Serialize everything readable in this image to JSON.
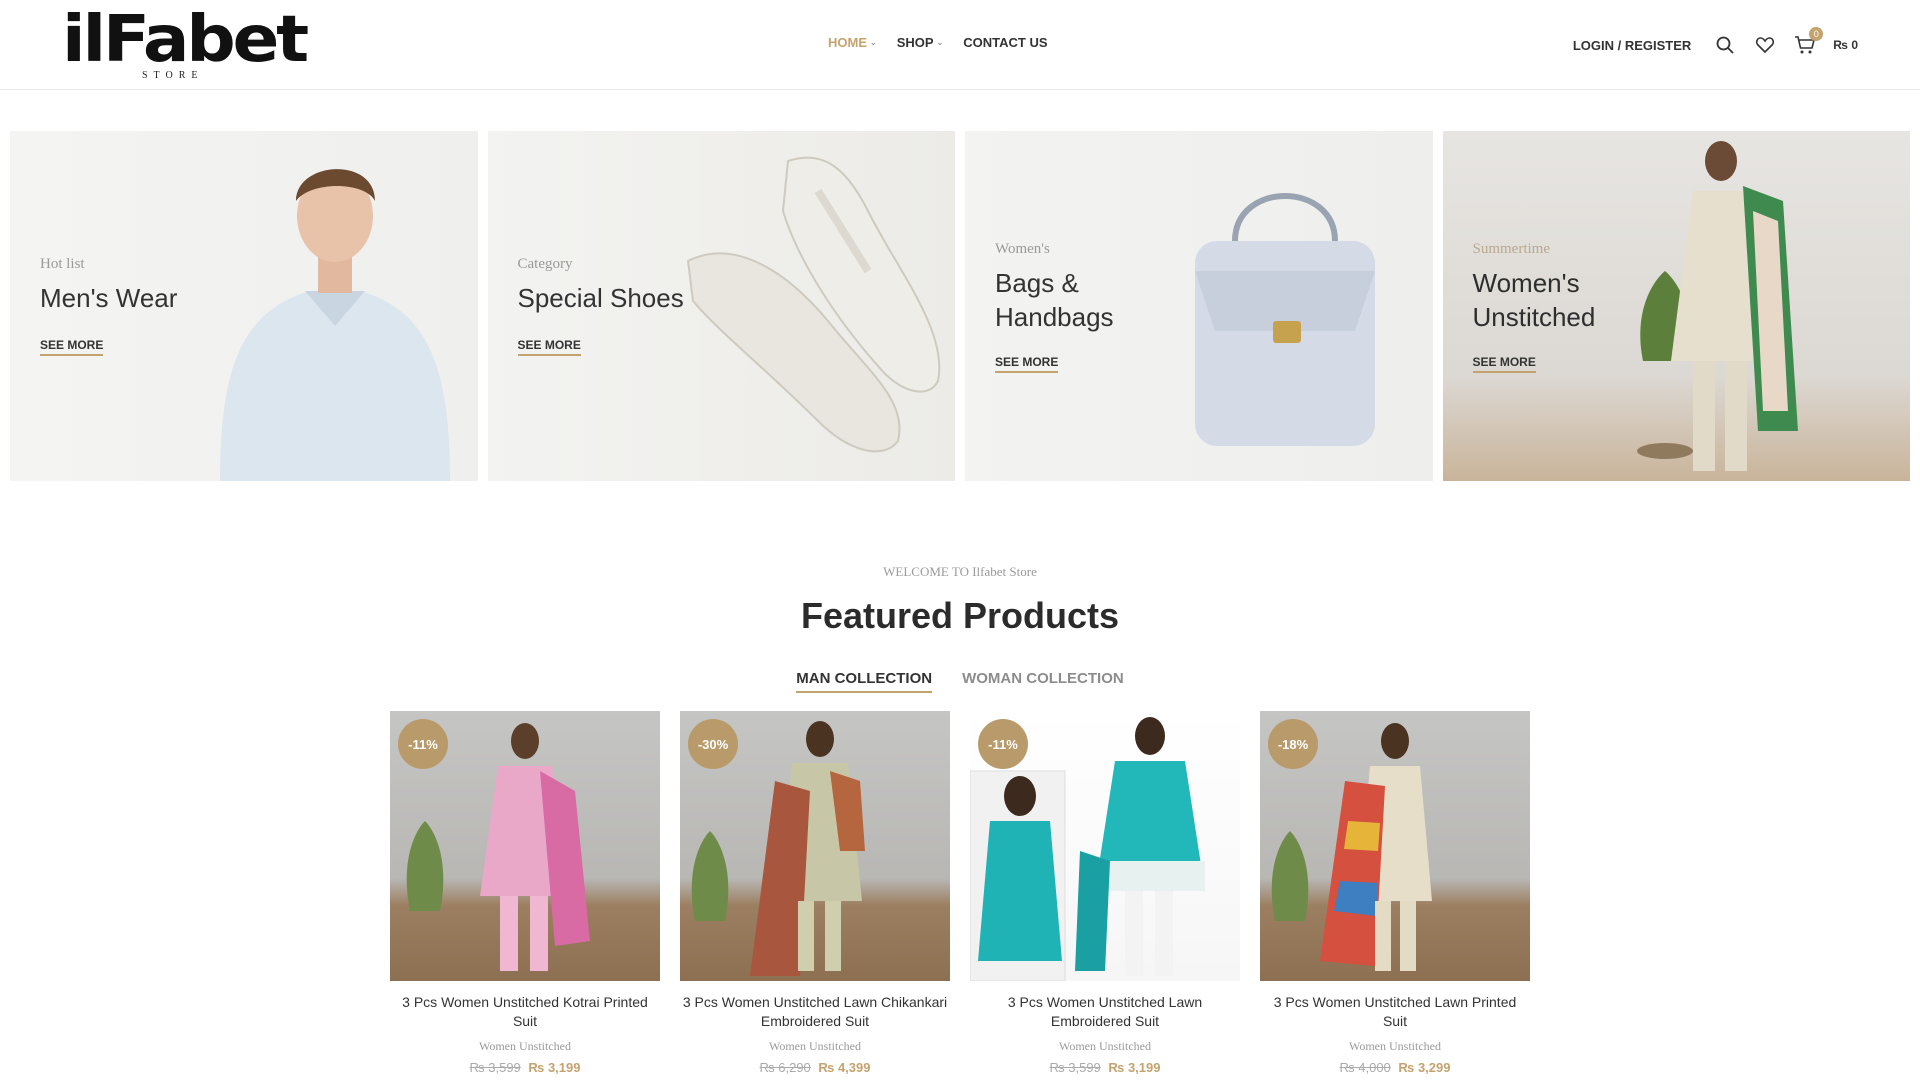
{
  "header": {
    "logo_text": "ilFabet",
    "logo_sub": "STORE",
    "nav": [
      {
        "label": "HOME",
        "active": true,
        "has_dropdown": true
      },
      {
        "label": "SHOP",
        "active": false,
        "has_dropdown": true
      },
      {
        "label": "CONTACT US",
        "active": false,
        "has_dropdown": false
      }
    ],
    "login_label": "LOGIN / REGISTER",
    "icons": [
      "search-icon",
      "heart-icon",
      "cart-icon"
    ],
    "cart_count": "0",
    "cart_total": "₨ 0"
  },
  "banners": [
    {
      "subtitle": "Hot list",
      "title": "Men's Wear",
      "link": "SEE MORE"
    },
    {
      "subtitle": "Category",
      "title": "Special Shoes",
      "link": "SEE MORE"
    },
    {
      "subtitle": "Women's",
      "title_line1": "Bags &",
      "title_line2": "Handbags",
      "link": "SEE MORE"
    },
    {
      "subtitle": "Summertime",
      "title_line1": "Women's",
      "title_line2": "Unstitched",
      "link": "SEE MORE"
    }
  ],
  "featured": {
    "welcome": "WELCOME TO Ilfabet Store",
    "title": "Featured Products",
    "tabs": [
      {
        "label": "MAN COLLECTION",
        "active": true
      },
      {
        "label": "WOMAN COLLECTION",
        "active": false
      }
    ],
    "products": [
      {
        "discount": "-11%",
        "name": "3 Pcs Women Unstitched Kotrai Printed Suit",
        "category": "Women Unstitched",
        "old_price": "₨ 3,599",
        "new_price": "₨ 3,199"
      },
      {
        "discount": "-30%",
        "name": "3 Pcs Women Unstitched Lawn Chikankari Embroidered Suit",
        "category": "Women Unstitched",
        "old_price": "₨ 6,290",
        "new_price": "₨ 4,399"
      },
      {
        "discount": "-11%",
        "name": "3 Pcs Women Unstitched Lawn Embroidered Suit",
        "category": "Women Unstitched",
        "old_price": "₨ 3,599",
        "new_price": "₨ 3,199"
      },
      {
        "discount": "-18%",
        "name": "3 Pcs Women Unstitched Lawn Printed Suit",
        "category": "Women Unstitched",
        "old_price": "₨ 4,000",
        "new_price": "₨ 3,299"
      }
    ]
  },
  "colors": {
    "accent": "#c4a36f",
    "text": "#333333",
    "muted": "#9a9a9a"
  }
}
